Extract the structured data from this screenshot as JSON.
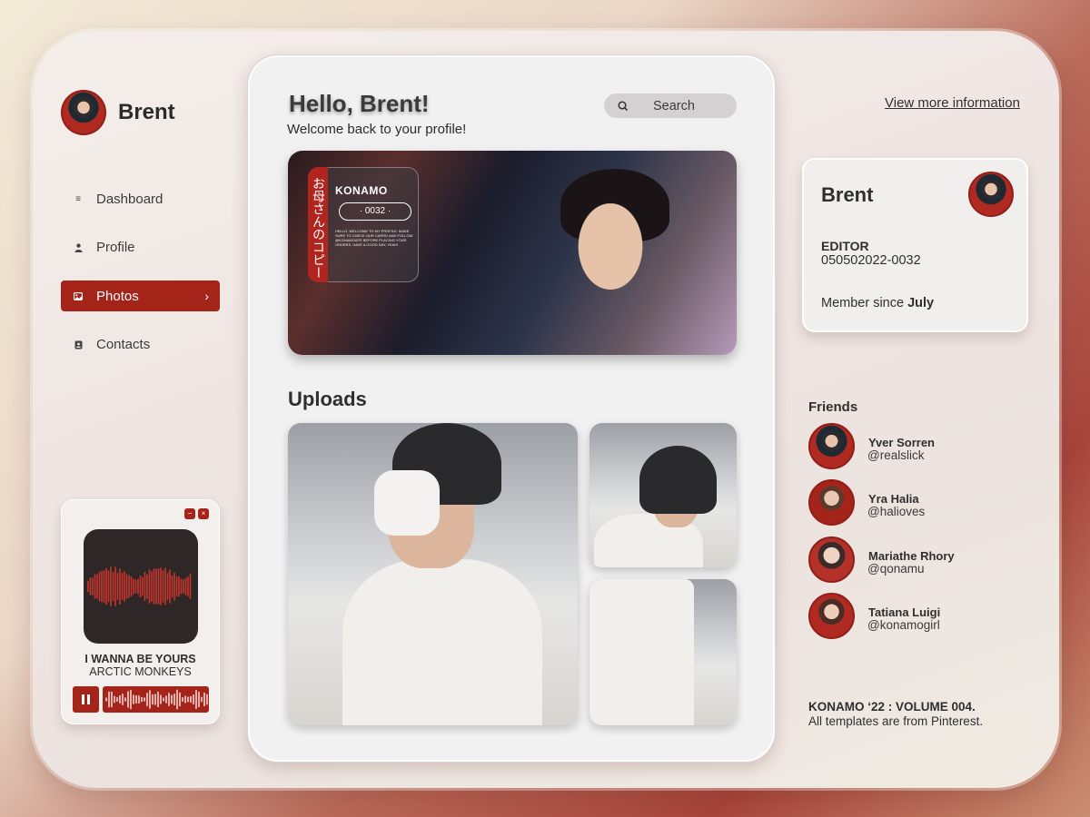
{
  "user": {
    "name": "Brent"
  },
  "sidebar": {
    "items": [
      {
        "label": "Dashboard",
        "icon": "menu-icon",
        "active": false
      },
      {
        "label": "Profile",
        "icon": "person-icon",
        "active": false
      },
      {
        "label": "Photos",
        "icon": "image-icon",
        "active": true
      },
      {
        "label": "Contacts",
        "icon": "contacts-icon",
        "active": false
      }
    ]
  },
  "player": {
    "minimize_label": "−",
    "close_label": "×",
    "song_title": "I WANNA BE YOURS",
    "artist": "ARCTIC MONKEYS"
  },
  "main": {
    "greeting": "Hello, Brent!",
    "welcome": "Welcome back to your profile!",
    "search_label": "Search",
    "hero": {
      "vertical_text": "お母さんのコピー",
      "brand": "KONAMO",
      "code": "· 0032 ·",
      "small_text": "HELLO, WELCOME TO MY PROFILE. MAKE SURE TO CHECK OUR CARRD AND FOLLOW @KONAMOAFE BEFORE PLACING YOUR ORDERS. HAVE A GOOD DAY, YEAH!"
    },
    "uploads_title": "Uploads"
  },
  "right": {
    "view_more": "View more information",
    "card": {
      "name": "Brent",
      "role": "EDITOR",
      "id": "050502022-0032",
      "member_prefix": "Member since ",
      "member_since": "July"
    },
    "friends_title": "Friends",
    "friends": [
      {
        "name": "Yver Sorren",
        "handle": "@realslick"
      },
      {
        "name": "Yra Halia",
        "handle": "@halioves"
      },
      {
        "name": "Mariathe Rhory",
        "handle": "@qonamu"
      },
      {
        "name": "Tatiana Luigi",
        "handle": "@konamogirl"
      }
    ],
    "footer_title": "KONAMO ‘22 : VOLUME 004.",
    "footer_sub": "All templates are from Pinterest."
  },
  "colors": {
    "accent": "#a5241a",
    "panel": "#f2f1f2",
    "album_bg": "#2e2627"
  }
}
